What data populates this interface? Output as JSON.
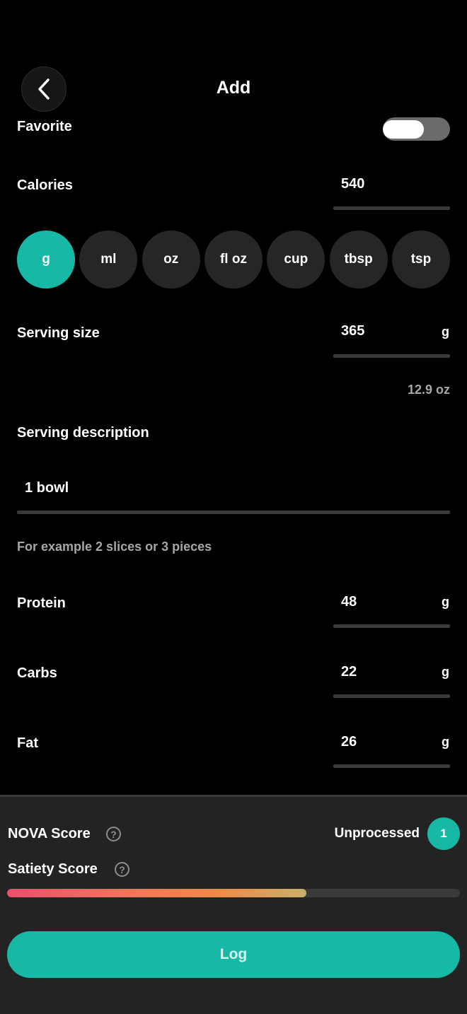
{
  "header": {
    "title": "Add",
    "back_icon": "chevron-left-icon"
  },
  "favorite": {
    "label": "Favorite",
    "on": true
  },
  "calories": {
    "label": "Calories",
    "value": "540"
  },
  "units": {
    "options": [
      "g",
      "ml",
      "oz",
      "fl oz",
      "cup",
      "tbsp",
      "tsp"
    ],
    "selected": "g"
  },
  "serving_size": {
    "label": "Serving size",
    "value": "365",
    "unit": "g",
    "converted": "12.9 oz"
  },
  "serving_description": {
    "label": "Serving description",
    "value": "1 bowl",
    "hint": "For example 2 slices or 3 pieces"
  },
  "protein": {
    "label": "Protein",
    "value": "48",
    "unit": "g"
  },
  "carbs": {
    "label": "Carbs",
    "value": "22",
    "unit": "g"
  },
  "fat": {
    "label": "Fat",
    "value": "26",
    "unit": "g"
  },
  "nova": {
    "label": "NOVA Score",
    "status": "Unprocessed",
    "score": "1",
    "help_icon": "question-circle-icon"
  },
  "satiety": {
    "label": "Satiety Score",
    "level_fraction": 0.661,
    "help_icon": "question-circle-icon"
  },
  "log_button": {
    "label": "Log"
  },
  "colors": {
    "accent": "#17b8a6",
    "background": "#000000",
    "panel": "#232323",
    "pill": "#262626"
  }
}
